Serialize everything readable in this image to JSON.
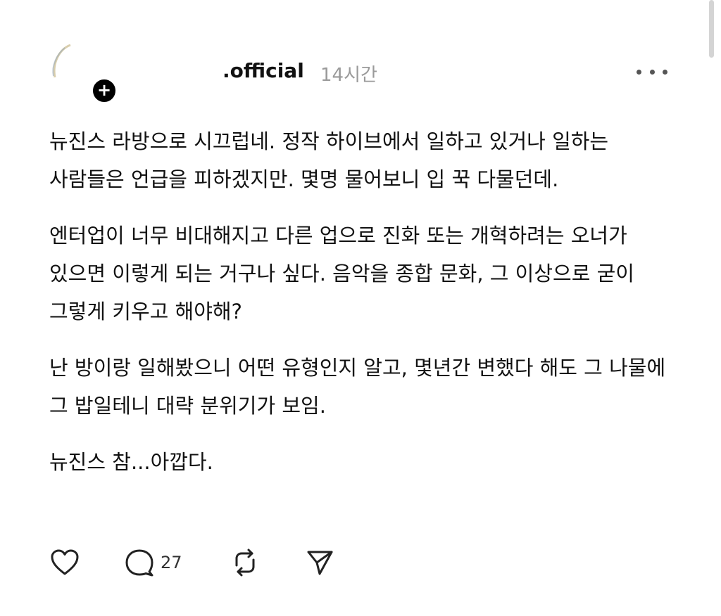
{
  "post": {
    "username": ".official",
    "timestamp": "14시간",
    "paragraphs": [
      "뉴진스 라방으로 시끄럽네. 정작 하이브에서 일하고 있거나 일하는 사람들은 언급을 피하겠지만. 몇명 물어보니 입 꾹 다물던데.",
      "엔터업이 너무 비대해지고 다른 업으로 진화 또는 개혁하려는 오너가 있으면 이렇게 되는 거구나 싶다. 음악을 종합 문화, 그 이상으로 굳이 그렇게 키우고 해야해?",
      "난 방이랑 일해봤으니 어떤 유형인지 알고, 몇년간 변했다 해도 그 나물에 그 밥일테니 대략 분위기가 보임.",
      "뉴진스 참...아깝다."
    ]
  },
  "actions": {
    "like_icon": "heart-icon",
    "comment_icon": "comment-bubble-icon",
    "comment_count": "27",
    "repost_icon": "repost-icon",
    "share_icon": "send-icon"
  },
  "colors": {
    "text": "#111111",
    "muted": "#9a9a9a",
    "icon": "#222222"
  }
}
